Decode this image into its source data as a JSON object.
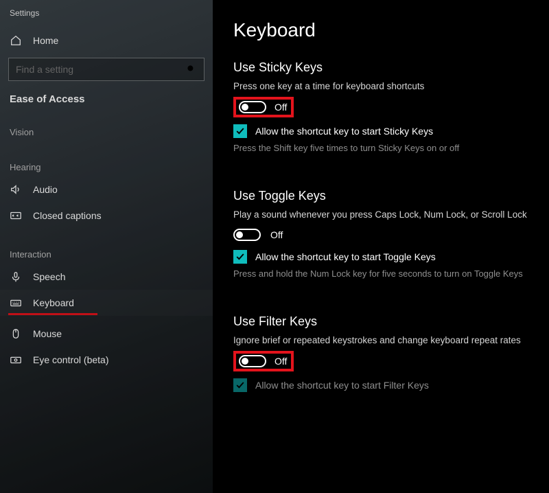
{
  "window": {
    "title": "Settings"
  },
  "sidebar": {
    "home": "Home",
    "search_placeholder": "Find a setting",
    "section": "Ease of Access",
    "groups": {
      "vision": "Vision",
      "hearing": "Hearing",
      "interaction": "Interaction"
    },
    "items": {
      "audio": "Audio",
      "closed_captions": "Closed captions",
      "speech": "Speech",
      "keyboard": "Keyboard",
      "mouse": "Mouse",
      "eye_control": "Eye control (beta)"
    }
  },
  "page": {
    "title": "Keyboard",
    "sticky": {
      "title": "Use Sticky Keys",
      "desc": "Press one key at a time for keyboard shortcuts",
      "toggle": "Off",
      "check": "Allow the shortcut key to start Sticky Keys",
      "hint": "Press the Shift key five times to turn Sticky Keys on or off"
    },
    "toggle_keys": {
      "title": "Use Toggle Keys",
      "desc": "Play a sound whenever you press Caps Lock, Num Lock, or Scroll Lock",
      "toggle": "Off",
      "check": "Allow the shortcut key to start Toggle Keys",
      "hint": "Press and hold the Num Lock key for five seconds to turn on Toggle Keys"
    },
    "filter": {
      "title": "Use Filter Keys",
      "desc": "Ignore brief or repeated keystrokes and change keyboard repeat rates",
      "toggle": "Off",
      "cut": "Allow the shortcut key to start Filter Keys"
    }
  }
}
